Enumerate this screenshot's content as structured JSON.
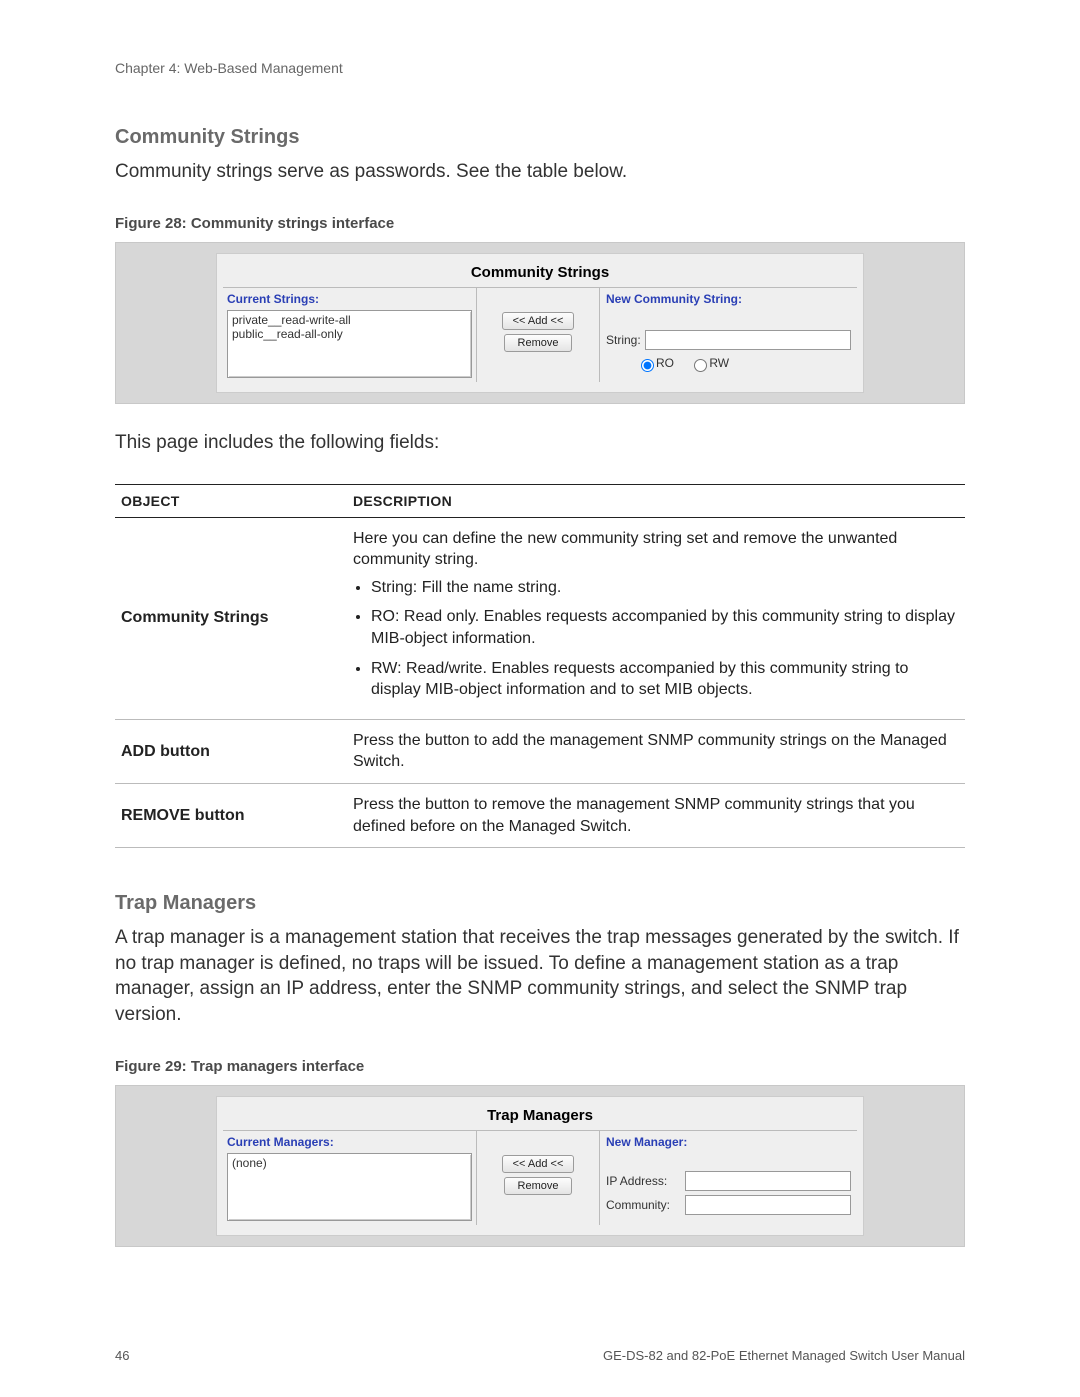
{
  "running_head": "Chapter 4: Web-Based Management",
  "section1": {
    "heading": "Community Strings",
    "intro": "Community strings serve as passwords. See the table below.",
    "figure_caption": "Figure 28:  Community strings interface",
    "ui": {
      "title": "Community Strings",
      "left_head": "Current Strings:",
      "right_head": "New Community String:",
      "list_items": [
        "private__read-write-all",
        "public__read-all-only"
      ],
      "btn_add": "<< Add <<",
      "btn_remove": "Remove",
      "string_label": "String:",
      "string_value": "",
      "radio_ro": "RO",
      "radio_rw": "RW",
      "radio_selected": "RO"
    }
  },
  "fields_intro": "This page includes the following fields:",
  "fields_table": {
    "col_object": "Object",
    "col_desc": "Description",
    "rows": [
      {
        "object": "Community Strings",
        "desc_lead": "Here you can define the new community string set and remove the unwanted community string.",
        "bullets": [
          "String: Fill the name string.",
          "RO: Read only. Enables requests accompanied by this community string to display MIB-object information.",
          "RW: Read/write. Enables requests accompanied by this community string to display MIB-object information and to set MIB objects."
        ]
      },
      {
        "object": "ADD button",
        "desc_lead": "Press the button to add the management SNMP community strings on the Managed Switch."
      },
      {
        "object": "REMOVE button",
        "desc_lead": "Press the button to remove the management SNMP community strings that you defined before on the Managed Switch."
      }
    ]
  },
  "section2": {
    "heading": "Trap Managers",
    "intro": "A trap manager is a management station that receives the trap messages generated by the switch. If no trap manager is defined, no traps will be issued. To define a management station as a trap manager, assign an IP address, enter the SNMP community strings, and select the SNMP trap version.",
    "figure_caption": "Figure 29:  Trap managers interface",
    "ui": {
      "title": "Trap Managers",
      "left_head": "Current Managers:",
      "right_head": "New Manager:",
      "list_items": [
        "(none)"
      ],
      "btn_add": "<< Add <<",
      "btn_remove": "Remove",
      "ip_label": "IP Address:",
      "ip_value": "",
      "comm_label": "Community:",
      "comm_value": ""
    }
  },
  "footer": {
    "page": "46",
    "manual": "GE-DS-82 and 82-PoE Ethernet Managed Switch User Manual"
  }
}
